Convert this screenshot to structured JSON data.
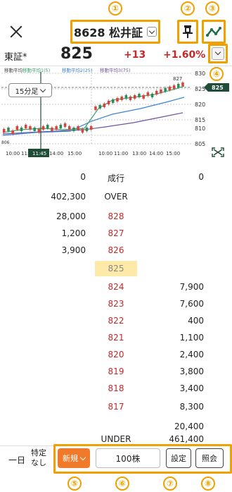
{
  "header": {
    "stock": "8628 松井証",
    "markers": [
      "①",
      "②",
      "③",
      "④",
      "⑤",
      "⑥",
      "⑦",
      "⑧"
    ]
  },
  "quote": {
    "exchange": "東証*",
    "price": "825",
    "change": "+13",
    "change_pct": "+1.60%"
  },
  "chart": {
    "ma_label": "移動平均",
    "ma_legend": [
      "移動平均1(5)",
      "移動平均2(25)",
      "移動平均3(75)"
    ],
    "interval": "15分足",
    "y_ticks": [
      "830",
      "825",
      "820",
      "815",
      "810",
      "805"
    ],
    "x_ticks": [
      "10:00",
      "11:00",
      "14:00",
      "15:00",
      "10:00",
      "11:00",
      "13:00",
      "14:00",
      "15:00"
    ],
    "cursor_time": "11:45",
    "high_label": "827",
    "low_label": "806",
    "current_tag": "825",
    "colors": {
      "ma1": "#3aa46b",
      "ma2": "#3b84d6",
      "ma3": "#6e54a3",
      "up": "#d8433b",
      "down": "#2e8b57"
    }
  },
  "board": {
    "market_row": {
      "ask": "0",
      "label": "成行",
      "bid": "0"
    },
    "over_row": {
      "ask": "402,300",
      "label": "OVER"
    },
    "asks": [
      {
        "qty": "28,000",
        "price": "828"
      },
      {
        "qty": "1,200",
        "price": "827"
      },
      {
        "qty": "3,900",
        "price": "826"
      }
    ],
    "current_price": "825",
    "bids": [
      {
        "price": "824",
        "qty": "7,900"
      },
      {
        "price": "823",
        "qty": "7,600"
      },
      {
        "price": "822",
        "qty": "400"
      },
      {
        "price": "821",
        "qty": "1,100"
      },
      {
        "price": "820",
        "qty": "2,400"
      },
      {
        "price": "819",
        "qty": "3,800"
      },
      {
        "price": "818",
        "qty": "3,400"
      },
      {
        "price": "817",
        "qty": "8,300"
      },
      {
        "price": "",
        "qty": "20,400"
      }
    ],
    "under_row": {
      "label": "UNDER",
      "bid": "461,400"
    }
  },
  "footer": {
    "day": "一日",
    "account_line1": "特定",
    "account_line2": "なし",
    "new_order": "新規",
    "quantity": "100株",
    "settings": "設定",
    "inquiry": "照会"
  }
}
